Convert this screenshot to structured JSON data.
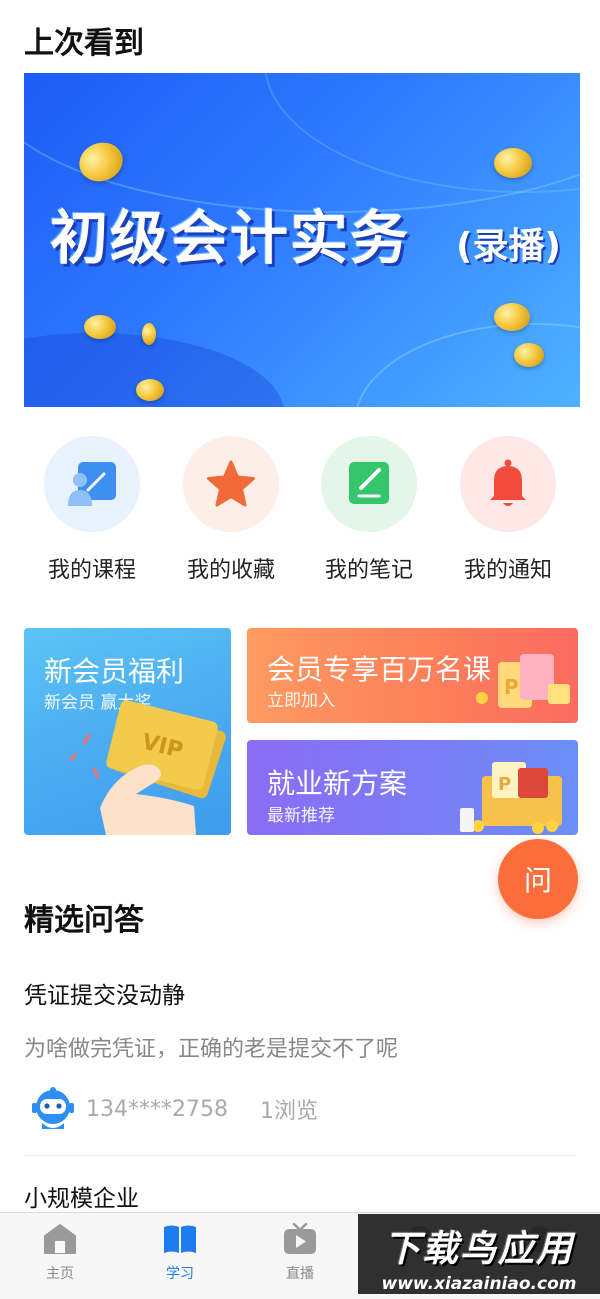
{
  "last_watched": {
    "title": "上次看到",
    "banner_title": "初级会计实务",
    "banner_subtitle": "(录播)"
  },
  "quick_links": [
    {
      "label": "我的课程",
      "icon": "course-icon",
      "bg": "#e8f2fd",
      "color": "#3f8ef1"
    },
    {
      "label": "我的收藏",
      "icon": "star-icon",
      "bg": "#fdeee6",
      "color": "#f06a3a"
    },
    {
      "label": "我的笔记",
      "icon": "note-icon",
      "bg": "#e3f6e9",
      "color": "#35c66c"
    },
    {
      "label": "我的通知",
      "icon": "bell-icon",
      "bg": "#fde8e6",
      "color": "#f24a3c"
    }
  ],
  "promos": {
    "new_member": {
      "title": "新会员福利",
      "subtitle": "新会员 赢大奖",
      "card_text": "VIP"
    },
    "vip_courses": {
      "title": "会员专享百万名课",
      "subtitle": "立即加入"
    },
    "employment": {
      "title": "就业新方案",
      "subtitle": "最新推荐"
    }
  },
  "ask_button": "问",
  "qa": {
    "title": "精选问答",
    "items": [
      {
        "question": "凭证提交没动静",
        "detail": "为啥做完凭证，正确的老是提交不了呢",
        "user": "134****2758",
        "views": "1浏览"
      },
      {
        "question": "小规模企业"
      }
    ]
  },
  "tabbar": [
    {
      "label": "主页",
      "icon": "home-icon",
      "active": false
    },
    {
      "label": "学习",
      "icon": "book-icon",
      "active": true
    },
    {
      "label": "直播",
      "icon": "tv-play-icon",
      "active": false
    },
    {
      "label": "",
      "icon": "tab-icon",
      "active": false
    },
    {
      "label": "",
      "icon": "tab-icon",
      "active": false
    }
  ],
  "watermark": {
    "line1": "下载鸟应用",
    "line2": "www.xiazainiao.com"
  },
  "colors": {
    "accent": "#1e7cf2",
    "fab": "#fb6e3c"
  }
}
